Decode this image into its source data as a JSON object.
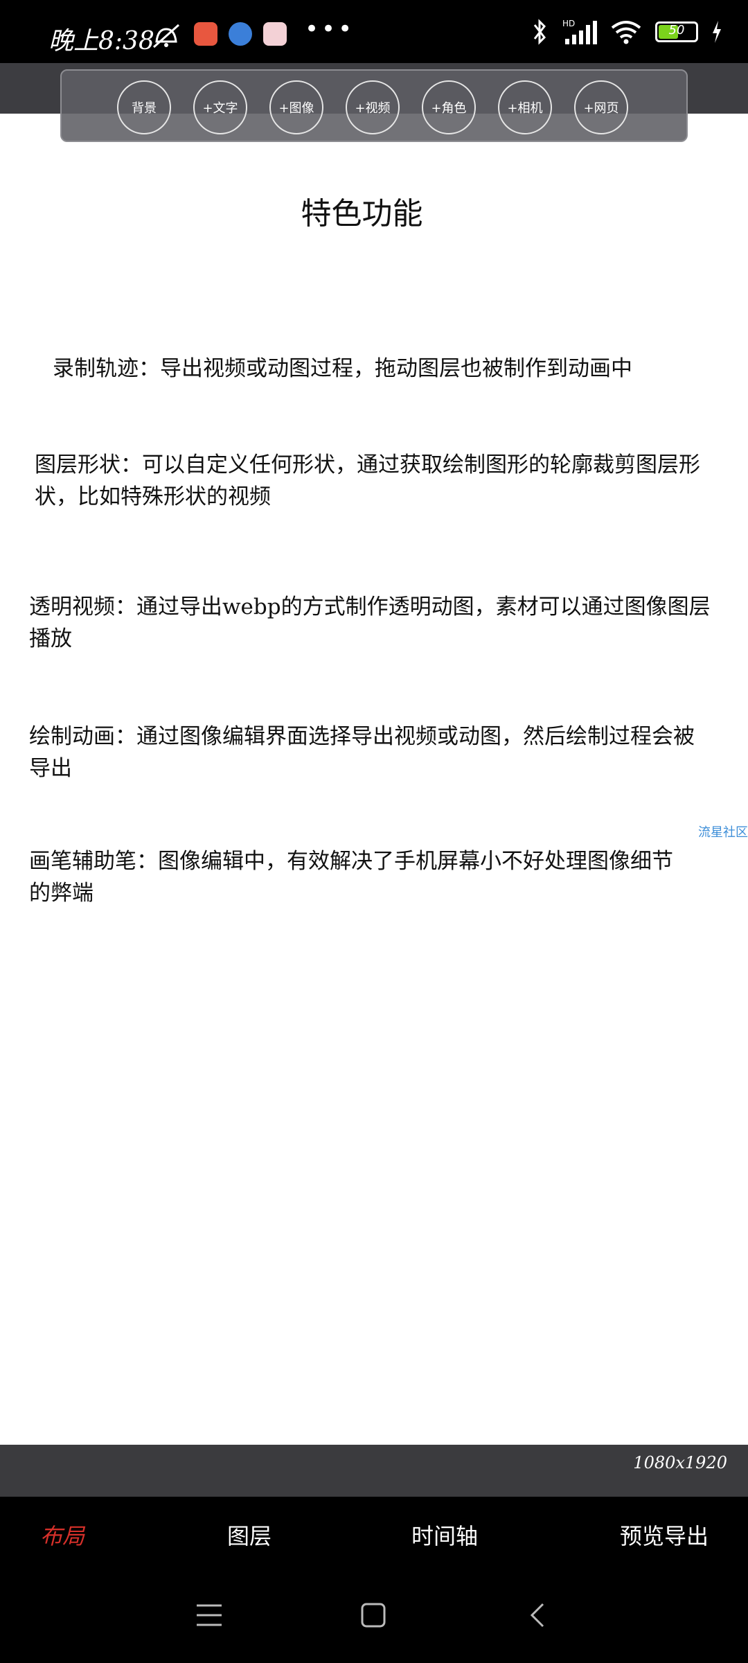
{
  "status_bar": {
    "time": "晚上8:38",
    "more": "•••",
    "battery": "50"
  },
  "toolbar": {
    "items": [
      "背景",
      "+文字",
      "+图像",
      "+视频",
      "+角色",
      "+相机",
      "+网页"
    ]
  },
  "content": {
    "title": "特色功能",
    "paragraphs": [
      "录制轨迹：导出视频或动图过程，拖动图层也被制作到动画中",
      "图层形状：可以自定义任何形状，通过获取绘制图形的轮廓裁剪图层形状，比如特殊形状的视频",
      "透明视频：通过导出webp的方式制作透明动图，素材可以通过图像图层播放",
      "绘制动画：通过图像编辑界面选择导出视频或动图，然后绘制过程会被导出",
      "画笔辅助笔：图像编辑中，有效解决了手机屏幕小不好处理图像细节的弊端"
    ],
    "watermark": "流星社区"
  },
  "canvas_info": {
    "resolution": "1080x1920"
  },
  "bottom_tabs": {
    "items": [
      "布局",
      "图层",
      "时间轴",
      "预览导出"
    ],
    "active": "布局"
  },
  "colors": {
    "active_tab": "#d6302a",
    "battery_fill": "#7bd31c",
    "link": "#3d8ed8"
  }
}
